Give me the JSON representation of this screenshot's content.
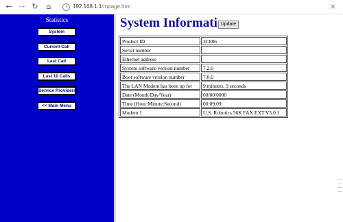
{
  "browser": {
    "url_host": "192.168.1.1",
    "url_path": "/mpage.htm"
  },
  "sidebar": {
    "title": "Statistics",
    "items": [
      {
        "label": "System"
      },
      {
        "label": "Current Call"
      },
      {
        "label": "Last Call"
      },
      {
        "label": "Last 10 Calls"
      },
      {
        "label": "Service Providers"
      },
      {
        "label": "<< Main Menu"
      }
    ]
  },
  "main": {
    "title": "System Information",
    "update_label": "Update",
    "rows": [
      {
        "label": "Product ID",
        "value": "3C886"
      },
      {
        "label": "Serial number",
        "value": ""
      },
      {
        "label": "Ethernet address",
        "value": ""
      },
      {
        "label": "System software version number",
        "value": "7.2.0"
      },
      {
        "label": "Boot software version number",
        "value": "7.0.0"
      },
      {
        "label": "The LAN Modem has been up for",
        "value": "9 minutes, 9 seconds"
      },
      {
        "label": "Date (Month/Day/Year)",
        "value": "00/00/0000"
      },
      {
        "label": "Time (Hour:Minute:Second)",
        "value": "00:09:09"
      },
      {
        "label": "Modem 1",
        "value": "U.S. Robotics 56K FAX EXT V5.0.1"
      }
    ]
  },
  "colors": {
    "sidebar_bg": "#0000c8",
    "title_color": "#1010a0"
  }
}
